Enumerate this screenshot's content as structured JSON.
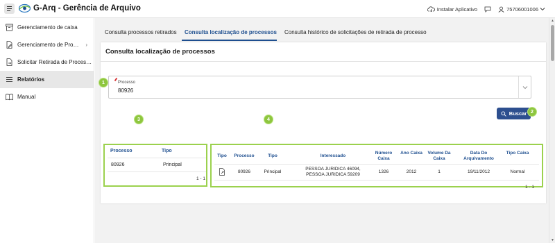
{
  "header": {
    "app_title": "G-Arq - Gerência de Arquivo",
    "install_label": "Instalar Aplicativo",
    "user_label": "75706001006"
  },
  "sidebar": {
    "items": [
      {
        "label": "Gerenciamento de caixa",
        "icon": "archive-box-icon",
        "has_arrow": false,
        "active": false
      },
      {
        "label": "Gerenciamento de Pro…",
        "icon": "document-edit-icon",
        "has_arrow": true,
        "active": false
      },
      {
        "label": "Solicitar Retirada de Proces…",
        "icon": "document-arrow-icon",
        "has_arrow": false,
        "active": false
      },
      {
        "label": "Relatórios",
        "icon": "list-icon",
        "has_arrow": false,
        "active": true
      },
      {
        "label": "Manual",
        "icon": "book-icon",
        "has_arrow": false,
        "active": false
      }
    ],
    "arrow_glyph": "›"
  },
  "tabs": [
    {
      "label": "Consulta processos retirados",
      "active": false
    },
    {
      "label": "Consulta localização de processos",
      "active": true
    },
    {
      "label": "Consulta histórico de solicitações de retirada de processo",
      "active": false
    }
  ],
  "card": {
    "title": "Consulta localização de processos",
    "process_field": {
      "label": "Processo",
      "value": "80926"
    },
    "search_button": "Buscar"
  },
  "badges": [
    "1",
    "2",
    "3",
    "4"
  ],
  "small_table": {
    "columns": [
      "Processo",
      "Tipo"
    ],
    "rows": [
      [
        "80926",
        "Principal"
      ]
    ],
    "pager": "1 - 1"
  },
  "detail_table": {
    "columns": [
      "Tipo",
      "Processo",
      "Tipo",
      "Interessado",
      "Número Caixa",
      "Ano Caixa",
      "Volume Da Caixa",
      "Data Do Arquivamento",
      "Tipo Caixa"
    ],
    "row": {
      "tipo_icon": "document-link-icon",
      "processo": "80926",
      "tipo": "Principal",
      "interessado": [
        "PESSOA JURIDICA 46094,",
        "PESSOA JURIDICA 59209"
      ],
      "numero_caixa": "1326",
      "ano_caixa": "2012",
      "volume": "1",
      "data": "19/11/2012",
      "tipo_caixa": "Normal"
    },
    "pager": "1 - 1"
  },
  "colors": {
    "accent": "#1d4e8f",
    "button": "#2d4f8f",
    "highlight": "#9bd14d",
    "badge": "#8ec63f"
  }
}
